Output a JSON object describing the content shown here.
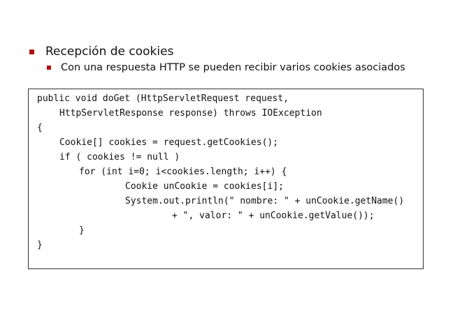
{
  "bullets": {
    "level1": "Recepción de cookies",
    "level2": "Con una respuesta HTTP se pueden recibir varios cookies asociados"
  },
  "code": {
    "lines": [
      "public void doGet (HttpServletRequest request,",
      "HttpServletResponse response) throws IOException",
      "{",
      "Cookie[] cookies = request.getCookies();",
      "if ( cookies != null )",
      "for (int i=0; i<cookies.length; i++) {",
      "Cookie unCookie = cookies[i];",
      "System.out.println(\" nombre: \" + unCookie.getName()",
      "+ \", valor: \" + unCookie.getValue());",
      "}",
      "}"
    ]
  },
  "colors": {
    "bullet": "#b01313",
    "border": "#333333"
  }
}
